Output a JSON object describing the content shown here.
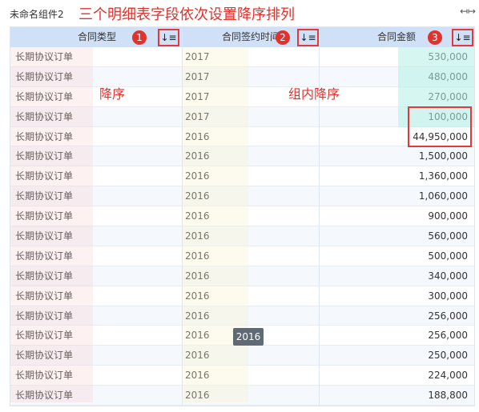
{
  "widget": {
    "name": "未命名组件2",
    "expand_icon": "expand-horizontal-icon"
  },
  "annotations": {
    "title": "三个明细表字段依次设置降序排列",
    "label_desc": "降序",
    "label_group_desc": "组内降序",
    "badges": [
      "1",
      "2",
      "3"
    ],
    "color": "#e2322e"
  },
  "columns": [
    {
      "label": "合同类型",
      "sort_icon": "sort-descending-icon"
    },
    {
      "label": "合同签约时间",
      "sort_icon": "sort-descending-icon"
    },
    {
      "label": "合同金额",
      "sort_icon": "sort-descending-icon"
    }
  ],
  "rows": [
    [
      "长期协议订单",
      "2017",
      "530,000"
    ],
    [
      "长期协议订单",
      "2017",
      "480,000"
    ],
    [
      "长期协议订单",
      "2017",
      "270,000"
    ],
    [
      "长期协议订单",
      "2017",
      "100,000"
    ],
    [
      "长期协议订单",
      "2016",
      "44,950,000"
    ],
    [
      "长期协议订单",
      "2016",
      "1,500,000"
    ],
    [
      "长期协议订单",
      "2016",
      "1,360,000"
    ],
    [
      "长期协议订单",
      "2016",
      "1,060,000"
    ],
    [
      "长期协议订单",
      "2016",
      "900,000"
    ],
    [
      "长期协议订单",
      "2016",
      "560,000"
    ],
    [
      "长期协议订单",
      "2016",
      "500,000"
    ],
    [
      "长期协议订单",
      "2016",
      "340,000"
    ],
    [
      "长期协议订单",
      "2016",
      "300,000"
    ],
    [
      "长期协议订单",
      "2016",
      "256,000"
    ],
    [
      "长期协议订单",
      "2016",
      "256,000"
    ],
    [
      "长期协议订单",
      "2016",
      "250,000"
    ],
    [
      "长期协议订单",
      "2016",
      "224,000"
    ],
    [
      "长期协议订单",
      "2016",
      "188,800"
    ]
  ],
  "tooltip": "2016"
}
